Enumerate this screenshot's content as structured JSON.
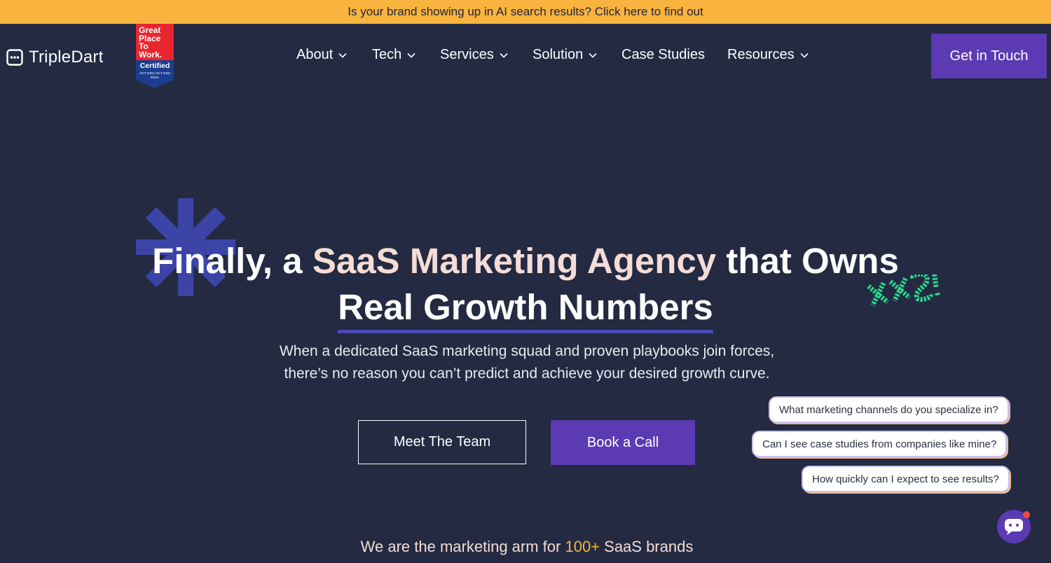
{
  "banner": {
    "text": "Is your brand showing up in AI search results? Click here to find out"
  },
  "brand": {
    "name": "TripleDart",
    "icon": "chat-bubble-dots-icon",
    "badge_lines": [
      "Great",
      "Place",
      "To",
      "Work."
    ],
    "badge_cert": "Certified",
    "badge_dates": "OCT 2025–OCT 2026",
    "badge_country": "INDIA"
  },
  "nav": [
    {
      "label": "About",
      "has_dropdown": true
    },
    {
      "label": "Tech",
      "has_dropdown": true
    },
    {
      "label": "Services",
      "has_dropdown": true
    },
    {
      "label": "Solution",
      "has_dropdown": true
    },
    {
      "label": "Case Studies",
      "has_dropdown": false
    },
    {
      "label": "Resources",
      "has_dropdown": true
    }
  ],
  "cta": {
    "label": "Get in Touch"
  },
  "hero": {
    "line1_part1": "Finally, a ",
    "line1_accent": "SaaS Marketing Agency",
    "line1_part2": " that Owns",
    "line2": "Real Growth Numbers",
    "sub_line1": "When a dedicated SaaS marketing squad and proven playbooks join forces,",
    "sub_line2": "there’s no reason you can’t predict and achieve your desired growth curve.",
    "btn_team": "Meet The Team",
    "btn_call": "Book a Call"
  },
  "chat": {
    "suggestions": [
      "What marketing channels do you specialize in?",
      "Can I see case studies from companies like mine?",
      "How quickly can I expect to see results?"
    ],
    "launcher_icon": "chat-bubble-icon"
  },
  "footer": {
    "part1": "We are the marketing arm for ",
    "number": "100+",
    "part2": " SaaS brands"
  },
  "colors": {
    "background": "#232a42",
    "banner": "#f8b43e",
    "primary": "#5b3ab3",
    "accent_text": "#f6dcd6",
    "underline": "#4a4bb4",
    "xo_green": "#2bd98a"
  }
}
